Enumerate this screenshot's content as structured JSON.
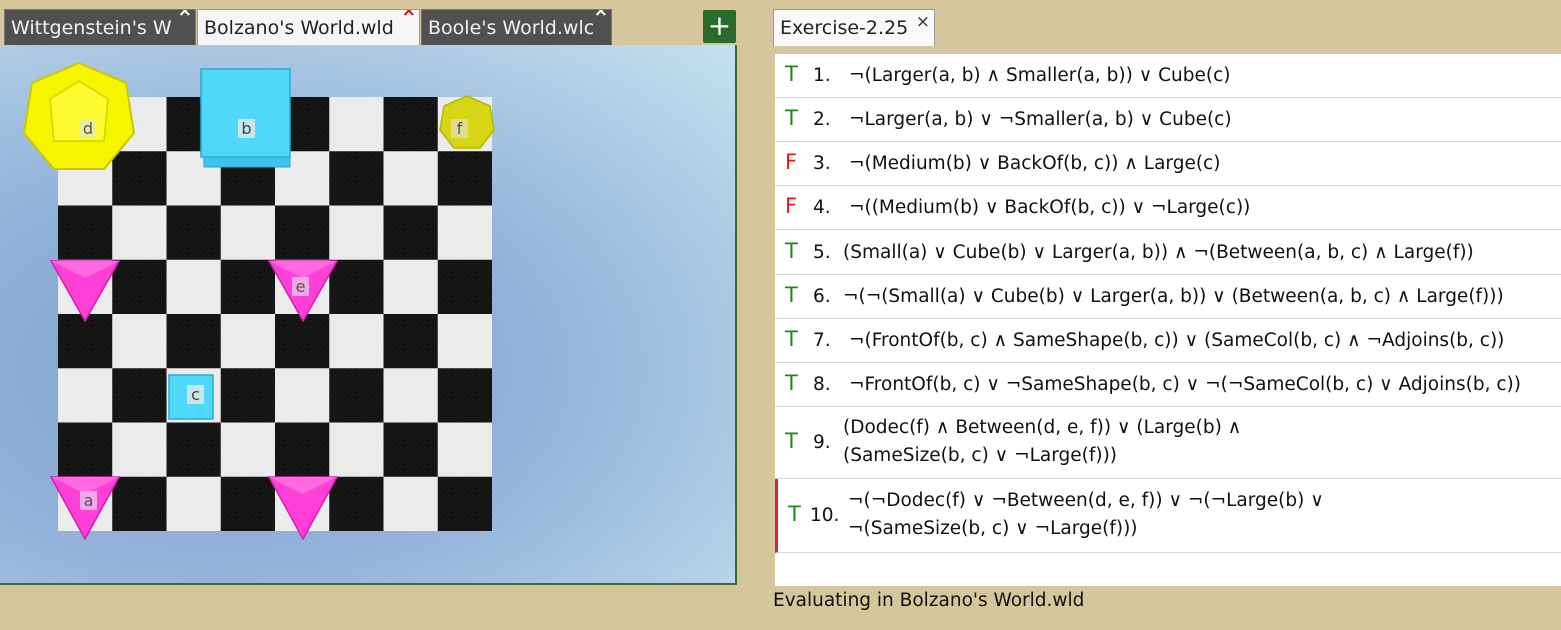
{
  "left_tabs": [
    {
      "label": "Wittgenstein's W",
      "close": "×"
    },
    {
      "label": "Bolzano's World.wld",
      "close": "×"
    },
    {
      "label": "Boole's World.wlc",
      "close": "×"
    }
  ],
  "add_button": "+",
  "world": {
    "objects": [
      {
        "label": "d",
        "shape": "dodec",
        "size": "large",
        "color": "#f5f500"
      },
      {
        "label": "b",
        "shape": "cube",
        "size": "large",
        "color": "#4fd8f8"
      },
      {
        "label": "f",
        "shape": "dodec",
        "size": "small",
        "color": "#d6d615"
      },
      {
        "label": "",
        "shape": "tet",
        "size": "medium",
        "color": "#ff3fd8"
      },
      {
        "label": "e",
        "shape": "tet",
        "size": "medium",
        "color": "#ff3fd8"
      },
      {
        "label": "c",
        "shape": "cube",
        "size": "small",
        "color": "#4fd8f8"
      },
      {
        "label": "a",
        "shape": "tet",
        "size": "medium",
        "color": "#ff3fd8"
      },
      {
        "label": "",
        "shape": "tet",
        "size": "medium",
        "color": "#ff3fd8"
      }
    ]
  },
  "right_tab": {
    "label": "Exercise-2.25",
    "close": "×"
  },
  "sentences": [
    {
      "tv": "T",
      "num": "1.",
      "lines": [
        "¬(Larger(a, b) ∧ Smaller(a, b)) ∨ Cube(c)"
      ]
    },
    {
      "tv": "T",
      "num": "2.",
      "lines": [
        "¬Larger(a, b) ∨ ¬Smaller(a, b) ∨ Cube(c)"
      ]
    },
    {
      "tv": "F",
      "num": "3.",
      "lines": [
        "¬(Medium(b) ∨ BackOf(b, c)) ∧ Large(c)"
      ]
    },
    {
      "tv": "F",
      "num": "4.",
      "lines": [
        "¬((Medium(b) ∨ BackOf(b, c)) ∨ ¬Large(c))"
      ]
    },
    {
      "tv": "T",
      "num": "5.",
      "lines": [
        "(Small(a) ∨ Cube(b) ∨ Larger(a, b)) ∧ ¬(Between(a, b, c) ∧ Large(f))"
      ]
    },
    {
      "tv": "T",
      "num": "6.",
      "lines": [
        "¬(¬(Small(a) ∨ Cube(b) ∨ Larger(a, b)) ∨ (Between(a, b, c) ∧ Large(f)))"
      ]
    },
    {
      "tv": "T",
      "num": "7.",
      "lines": [
        "¬(FrontOf(b, c) ∧ SameShape(b, c)) ∨ (SameCol(b, c) ∧ ¬Adjoins(b, c))"
      ]
    },
    {
      "tv": "T",
      "num": "8.",
      "lines": [
        "¬FrontOf(b, c) ∨ ¬SameShape(b, c) ∨ ¬(¬SameCol(b, c) ∨ Adjoins(b, c))"
      ]
    },
    {
      "tv": "T",
      "num": "9.",
      "lines": [
        "(Dodec(f) ∧ Between(d, e, f)) ∨ (Large(b) ∧",
        "(SameSize(b, c) ∨ ¬Large(f)))"
      ]
    },
    {
      "tv": "T",
      "num": "10.",
      "lines": [
        "¬(¬Dodec(f) ∨ ¬Between(d, e, f)) ∨ ¬(¬Large(b) ∨",
        "¬(SameSize(b, c) ∨ ¬Large(f)))"
      ]
    }
  ],
  "colors": {
    "true": "#1b8a1b",
    "false": "#e01818",
    "selected": "#d0283a"
  },
  "status": "Evaluating in Bolzano's World.wld"
}
